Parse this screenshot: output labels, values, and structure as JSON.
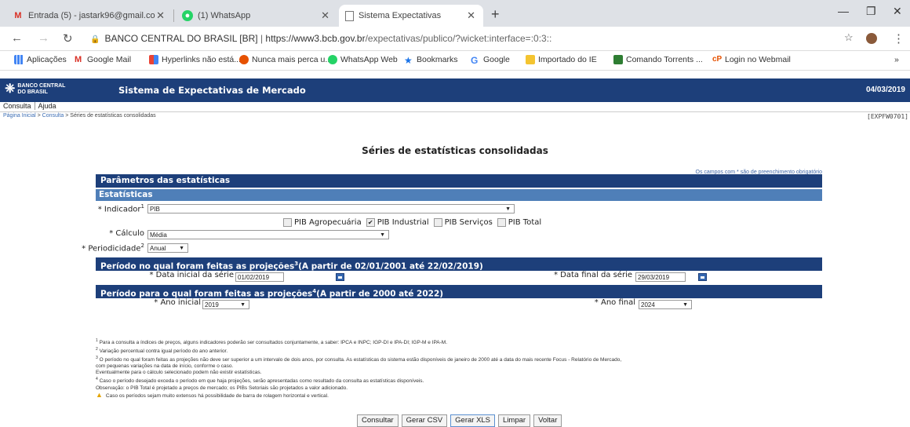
{
  "browser": {
    "tabs": [
      {
        "label": "Entrada (5) - jastark96@gmail.co",
        "icon": "gmail-icon"
      },
      {
        "label": "(1) WhatsApp",
        "icon": "whatsapp-icon"
      },
      {
        "label": "Sistema Expectativas",
        "icon": "page-icon"
      }
    ],
    "address": {
      "site": "BANCO CENTRAL DO BRASIL [BR]",
      "url_host": "https://www3.bcb.gov.br",
      "url_path": "/expectativas/publico/?wicket:interface=:0:3::"
    },
    "bookmarks": [
      "Aplicações",
      "Google Mail",
      "Hyperlinks não está...",
      "Nunca mais perca u...",
      "WhatsApp Web",
      "Bookmarks",
      "Google",
      "Importado do IE",
      "Comando Torrents ...",
      "Login no Webmail"
    ],
    "more": "»"
  },
  "header": {
    "logo_line1": "BANCO CENTRAL",
    "logo_line2": "DO BRASIL",
    "title": "Sistema de Expectativas de Mercado",
    "date": "04/03/2019"
  },
  "menu": [
    "Consulta",
    "Ajuda"
  ],
  "breadcrumb": {
    "home": "Página Inicial",
    "sep": ">",
    "section": "Consulta",
    "page": "Séries de estatísticas consolidadas"
  },
  "page_code": "[EXPFW0701]",
  "page_title": "Séries de estatísticas consolidadas",
  "required_note": "Os campos com * são de preenchimento obrigatório",
  "form": {
    "section_main": "Parâmetros das estatísticas",
    "section_stats": "Estatísticas",
    "indicador_label": "* Indicador",
    "indicador_value": "PIB",
    "checkboxes": [
      {
        "label": "PIB Agropecuária",
        "checked": false
      },
      {
        "label": "PIB Industrial",
        "checked": true
      },
      {
        "label": "PIB Serviços",
        "checked": false
      },
      {
        "label": "PIB Total",
        "checked": false
      }
    ],
    "calculo_label": "* Cálculo",
    "calculo_value": "Média",
    "periodicidade_label": "* Periodicidade",
    "periodicidade_value": "Anual",
    "section_period_made": "Período no qual foram feitas as projeções",
    "section_period_made_range": "(A partir de 02/01/2001 até 22/02/2019)",
    "data_inicial_label": "* Data inicial da série",
    "data_inicial_value": "01/02/2019",
    "data_final_label": "* Data final da série",
    "data_final_value": "29/03/2019",
    "section_period_for": "Período para o qual foram feitas as projeções",
    "section_period_for_range": "(A partir de 2000 até 2022)",
    "ano_inicial_label": "* Ano inicial",
    "ano_inicial_value": "2019",
    "ano_final_label": "* Ano final",
    "ano_final_value": "2024"
  },
  "notes": [
    "Para a consulta a índices de preços, alguns indicadores poderão ser consultados conjuntamente, a saber: IPCA e INPC; IGP-DI e IPA-DI; IGP-M e IPA-M.",
    "Variação percentual contra igual período do ano anterior.",
    "O período no qual foram feitas as projeções não deve ser superior a um intervalo de dois anos, por consulta. As estatísticas do sistema estão disponíveis de janeiro de 2000 até a data do mais recente Focus - Relatório de Mercado,",
    "com pequenas variações na data de início, conforme o caso.",
    "Eventualmente para o cálculo selecionado podem não existir estatísticas.",
    "Caso o período desejado exceda o período em que haja projeções, serão apresentadas como resultado da consulta as estatísticas disponíveis.",
    "Observação: o PIB Total é projetado a preços de mercado; os PIBs Setoriais são projetados a valor adicionado.",
    "Caso os períodos sejam muito extensos há possibilidade de barra de rolagem horizontal e vertical."
  ],
  "buttons": [
    "Consultar",
    "Gerar CSV",
    "Gerar XLS",
    "Limpar",
    "Voltar"
  ]
}
